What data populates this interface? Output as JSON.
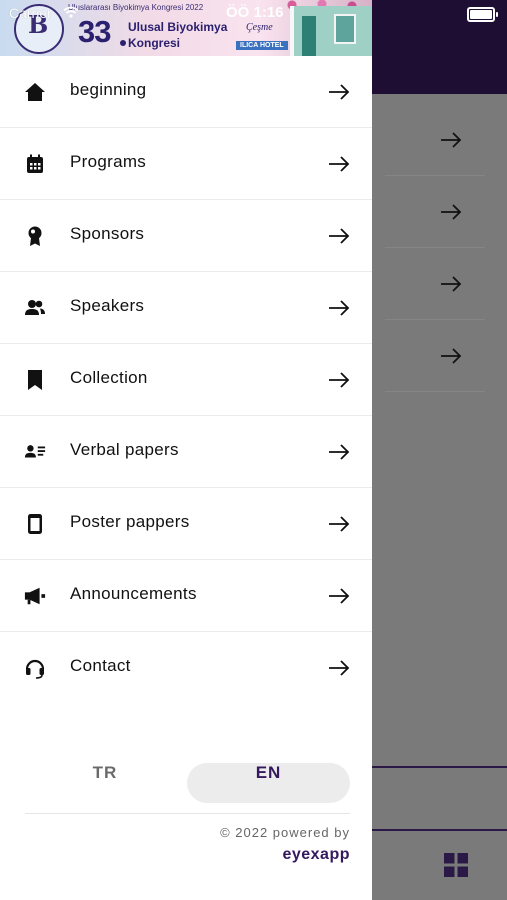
{
  "status_bar": {
    "carrier": "Carrier",
    "time": "ÖÖ 1:16"
  },
  "banner": {
    "top_text": "Uluslararası Biyokimya Kongresi 2022",
    "number": "33",
    "title_line1": "Ulusal Biyokimya",
    "title_line2": "Kongresi",
    "venue": "Çeşme",
    "hotel": "ILICA HOTEL"
  },
  "menu": {
    "items": [
      {
        "label": "beginning",
        "icon": "home-icon"
      },
      {
        "label": "Programs",
        "icon": "calendar-icon"
      },
      {
        "label": "Sponsors",
        "icon": "award-icon"
      },
      {
        "label": "Speakers",
        "icon": "users-icon"
      },
      {
        "label": "Collection",
        "icon": "bookmark-icon"
      },
      {
        "label": "Verbal papers",
        "icon": "contact-card-icon"
      },
      {
        "label": "Poster pappers",
        "icon": "tablet-icon"
      },
      {
        "label": "Announcements",
        "icon": "megaphone-icon"
      },
      {
        "label": "Contact",
        "icon": "headset-icon"
      }
    ]
  },
  "language": {
    "tr": "TR",
    "en": "EN",
    "selected": "EN"
  },
  "footer": {
    "powered": "© 2022 powered by",
    "brand": "eyexapp"
  },
  "colors": {
    "accent": "#35185e",
    "header_dark": "#1e0e33",
    "overlay": "#7a7a7a"
  }
}
